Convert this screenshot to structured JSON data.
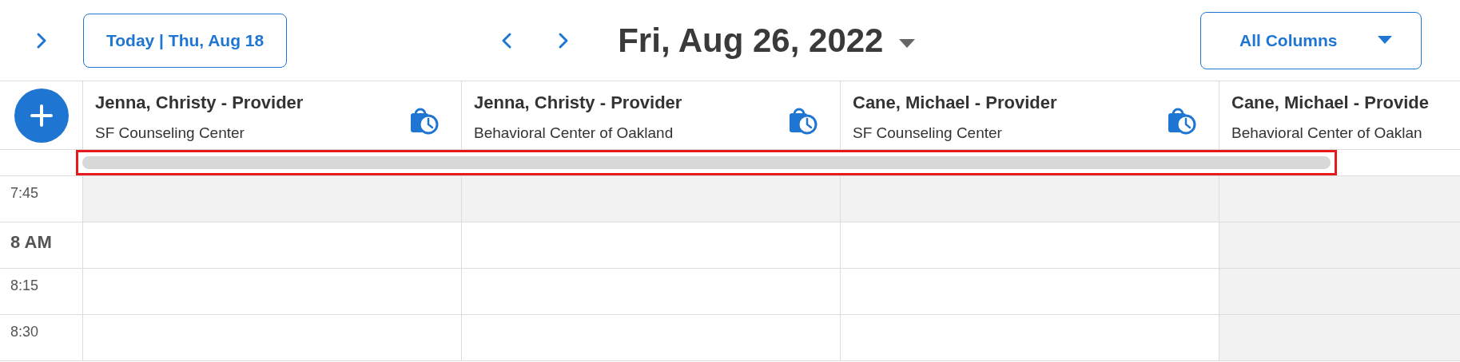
{
  "toolbar": {
    "today_button": "Today | Thu, Aug 18",
    "date_title": "Fri, Aug 26, 2022",
    "columns_select": "All Columns"
  },
  "columns": [
    {
      "name": "Jenna, Christy - Provider",
      "location": "SF Counseling Center",
      "has_icon": true
    },
    {
      "name": "Jenna, Christy - Provider",
      "location": "Behavioral Center of Oakland",
      "has_icon": true
    },
    {
      "name": "Cane, Michael - Provider",
      "location": "SF Counseling Center",
      "has_icon": true
    },
    {
      "name": "Cane, Michael - Provide",
      "location": "Behavioral Center of Oaklan"
    }
  ],
  "scrollbar": {
    "highlighted": true
  },
  "rows": [
    {
      "time": "7:45",
      "kind": "quarter",
      "cells": [
        {
          "unavailable": true
        },
        {
          "unavailable": true
        },
        {
          "unavailable": true
        },
        {
          "unavailable": true
        }
      ]
    },
    {
      "time": "8 AM",
      "kind": "hour",
      "cells": [
        {
          "unavailable": false
        },
        {
          "unavailable": false
        },
        {
          "unavailable": false
        },
        {
          "unavailable": true
        }
      ]
    },
    {
      "time": "8:15",
      "kind": "quarter",
      "cells": [
        {
          "unavailable": false
        },
        {
          "unavailable": false
        },
        {
          "unavailable": false
        },
        {
          "unavailable": true
        }
      ]
    },
    {
      "time": "8:30",
      "kind": "quarter",
      "cells": [
        {
          "unavailable": false
        },
        {
          "unavailable": false
        },
        {
          "unavailable": false
        },
        {
          "unavailable": true
        }
      ]
    }
  ]
}
